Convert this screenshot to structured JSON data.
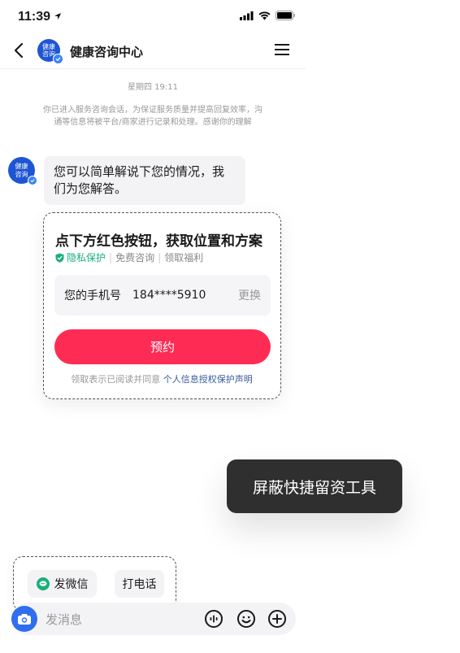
{
  "status": {
    "time": "11:39"
  },
  "header": {
    "title": "健康咨询中心",
    "avatar_text": "健康\n咨询"
  },
  "chat": {
    "timestamp": "星期四 19:11",
    "notice": "你已进入服务咨询会话，为保证服务质量并提高回复效率，沟通等信息将被平台/商家进行记录和处理。感谢你的理解",
    "bot_avatar_text": "健康\n咨询",
    "bot_message": "您可以简单解说下您的情况，我们为您解答。"
  },
  "card": {
    "title": "点下方红色按钮，获取位置和方案",
    "tags": [
      "隐私保护",
      "免费咨询",
      "领取福利"
    ],
    "phone_label": "您的手机号",
    "phone_number": "184****5910",
    "change_label": "更换",
    "button_label": "预约",
    "consent_text": "领取表示已阅读并同意",
    "consent_link": "个人信息授权保护声明"
  },
  "tooltip": {
    "text": "屏蔽快捷留资工具"
  },
  "quick_actions": {
    "wechat_label": "发微信",
    "call_label": "打电话"
  },
  "input": {
    "placeholder": "发消息"
  },
  "colors": {
    "accent_red": "#fe2c55",
    "brand_blue": "#1e55d3",
    "green": "#1ab07a"
  },
  "icons": [
    "location-arrow-icon",
    "signal-icon",
    "wifi-icon",
    "battery-icon",
    "back-chevron-icon",
    "verified-badge-icon",
    "menu-icon",
    "shield-check-icon",
    "wechat-icon",
    "camera-icon",
    "voice-icon",
    "emoji-icon",
    "plus-icon"
  ]
}
